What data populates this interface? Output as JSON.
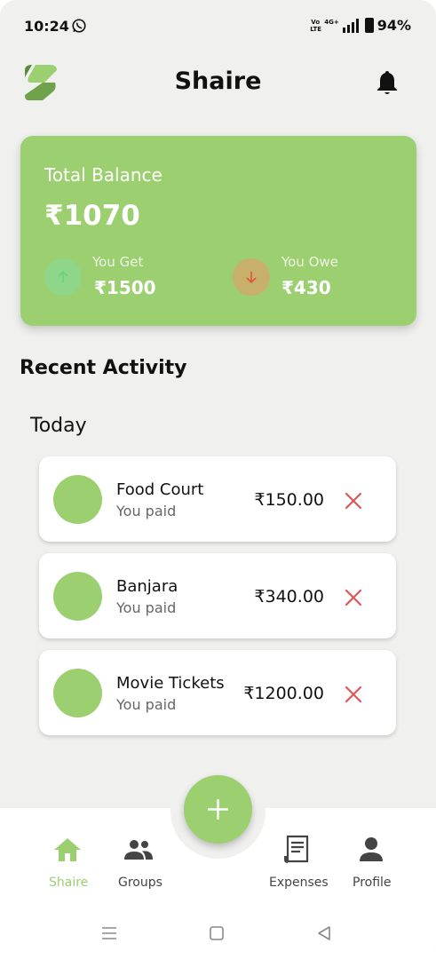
{
  "status_bar": {
    "time": "10:24",
    "volte": "Vo LTE",
    "network": "4G+",
    "battery": "94%"
  },
  "header": {
    "title": "Shaire",
    "logo_icon": "shaire-logo",
    "bell_icon": "bell-icon"
  },
  "balance": {
    "label": "Total Balance",
    "amount": "₹1070",
    "get_label": "You Get",
    "get_amount": "₹1500",
    "owe_label": "You Owe",
    "owe_amount": "₹430"
  },
  "recent": {
    "title": "Recent Activity",
    "day": "Today",
    "items": [
      {
        "name": "Food Court",
        "sub": "You paid",
        "amount": "₹150.00"
      },
      {
        "name": "Banjara",
        "sub": "You paid",
        "amount": "₹340.00"
      },
      {
        "name": "Movie Tickets",
        "sub": "You paid",
        "amount": "₹1200.00"
      }
    ]
  },
  "nav": {
    "items": [
      {
        "label": "Shaire",
        "icon": "home-icon",
        "active": true
      },
      {
        "label": "Groups",
        "icon": "groups-icon",
        "active": false
      },
      {
        "label": "Expenses",
        "icon": "receipt-icon",
        "active": false
      },
      {
        "label": "Profile",
        "icon": "person-icon",
        "active": false
      }
    ],
    "fab_icon": "plus-icon"
  },
  "colors": {
    "accent": "#9bcf70",
    "background": "#f0f0ee",
    "delete": "#e05555",
    "nav_active": "#9bcf70",
    "nav_inactive": "#444444"
  }
}
